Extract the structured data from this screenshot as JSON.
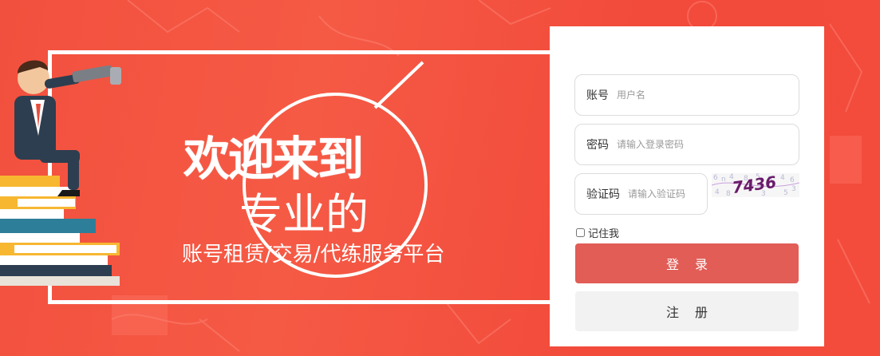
{
  "banner": {
    "line1": "欢迎来到",
    "line2": "专业的",
    "line3": "账号租赁/交易/代练服务平台",
    "bg_color": "#f24e3d"
  },
  "login": {
    "username_label": "账号",
    "username_placeholder": "用户名",
    "password_label": "密码",
    "password_placeholder": "请输入登录密码",
    "captcha_label": "验证码",
    "captcha_placeholder": "请输入验证码",
    "captcha_text": "7436",
    "remember_label": "记住我",
    "login_button": "登录",
    "register_button": "注册",
    "login_color": "#e15d56",
    "register_color": "#f2f2f2"
  }
}
